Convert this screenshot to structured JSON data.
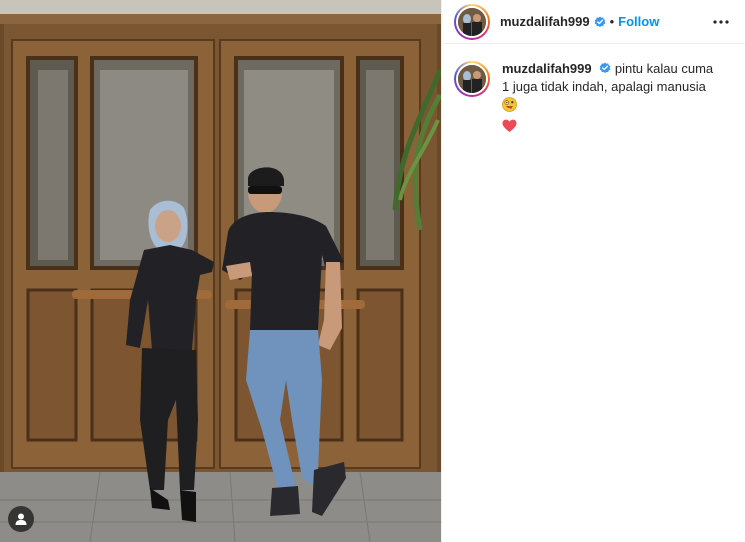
{
  "post": {
    "author": {
      "username": "muzdalifah999",
      "verified": true,
      "avatar_icon": "profile-photo"
    },
    "follow_label": "Follow",
    "separator": "•",
    "more_icon": "more-options-icon",
    "caption": {
      "username": "muzdalifah999",
      "text": "pintu kalau cuma 1 juga tidak indah, apalagi manusia",
      "emojis": [
        "zany-face-emoji",
        "red-heart-emoji"
      ]
    },
    "photo": {
      "tag_icon": "user-tag-icon"
    }
  },
  "colors": {
    "accent": "#0095f6",
    "verified": "#3897f0",
    "text": "#262626",
    "heart": "#ed4956"
  }
}
